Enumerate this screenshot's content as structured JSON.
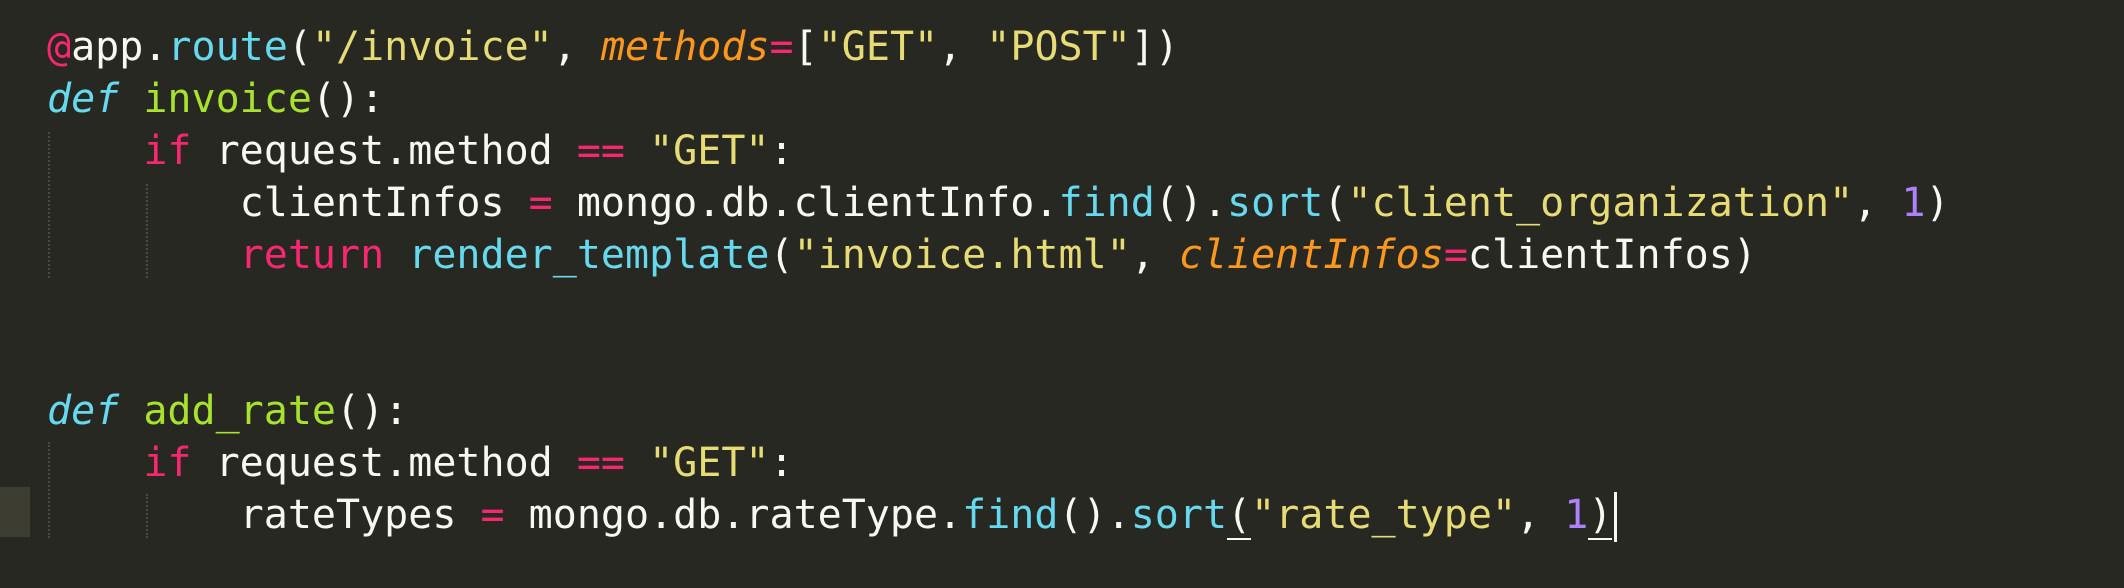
{
  "editor": {
    "colors": {
      "background": "#272822",
      "foreground": "#f8f8f2",
      "keyword": "#f92672",
      "storage": "#66d9ef",
      "function_name": "#a6e22e",
      "string": "#e6db74",
      "number": "#ae81ff",
      "parameter": "#fd971f"
    },
    "lines": [
      {
        "tokens": [
          {
            "type": "kw-deco",
            "text": "@"
          },
          {
            "type": "plain",
            "text": "app."
          },
          {
            "type": "fn-call",
            "text": "route"
          },
          {
            "type": "plain",
            "text": "("
          },
          {
            "type": "str",
            "text": "\"/invoice\""
          },
          {
            "type": "plain",
            "text": ", "
          },
          {
            "type": "param",
            "text": "methods"
          },
          {
            "type": "op",
            "text": "="
          },
          {
            "type": "plain",
            "text": "["
          },
          {
            "type": "str",
            "text": "\"GET\""
          },
          {
            "type": "plain",
            "text": ", "
          },
          {
            "type": "str",
            "text": "\"POST\""
          },
          {
            "type": "plain",
            "text": "])"
          }
        ]
      },
      {
        "tokens": [
          {
            "type": "kw-def",
            "text": "def"
          },
          {
            "type": "plain",
            "text": " "
          },
          {
            "type": "fn-name",
            "text": "invoice"
          },
          {
            "type": "plain",
            "text": "():"
          }
        ]
      },
      {
        "tokens": [
          {
            "type": "plain",
            "text": "    "
          },
          {
            "type": "kw",
            "text": "if"
          },
          {
            "type": "plain",
            "text": " request.method "
          },
          {
            "type": "op",
            "text": "=="
          },
          {
            "type": "plain",
            "text": " "
          },
          {
            "type": "str",
            "text": "\"GET\""
          },
          {
            "type": "plain",
            "text": ":"
          }
        ]
      },
      {
        "tokens": [
          {
            "type": "plain",
            "text": "        clientInfos "
          },
          {
            "type": "op",
            "text": "="
          },
          {
            "type": "plain",
            "text": " mongo.db.clientInfo."
          },
          {
            "type": "fn-call",
            "text": "find"
          },
          {
            "type": "plain",
            "text": "()."
          },
          {
            "type": "fn-call",
            "text": "sort"
          },
          {
            "type": "plain",
            "text": "("
          },
          {
            "type": "str",
            "text": "\"client_organization\""
          },
          {
            "type": "plain",
            "text": ", "
          },
          {
            "type": "num",
            "text": "1"
          },
          {
            "type": "plain",
            "text": ")"
          }
        ]
      },
      {
        "tokens": [
          {
            "type": "plain",
            "text": "        "
          },
          {
            "type": "kw",
            "text": "return"
          },
          {
            "type": "plain",
            "text": " "
          },
          {
            "type": "fn-call",
            "text": "render_template"
          },
          {
            "type": "plain",
            "text": "("
          },
          {
            "type": "str",
            "text": "\"invoice.html\""
          },
          {
            "type": "plain",
            "text": ", "
          },
          {
            "type": "param",
            "text": "clientInfos"
          },
          {
            "type": "op",
            "text": "="
          },
          {
            "type": "plain",
            "text": "clientInfos)"
          }
        ]
      },
      {
        "tokens": []
      },
      {
        "tokens": []
      },
      {
        "tokens": [
          {
            "type": "kw-def",
            "text": "def"
          },
          {
            "type": "plain",
            "text": " "
          },
          {
            "type": "fn-name",
            "text": "add_rate"
          },
          {
            "type": "plain",
            "text": "():"
          }
        ]
      },
      {
        "tokens": [
          {
            "type": "plain",
            "text": "    "
          },
          {
            "type": "kw",
            "text": "if"
          },
          {
            "type": "plain",
            "text": " request.method "
          },
          {
            "type": "op",
            "text": "=="
          },
          {
            "type": "plain",
            "text": " "
          },
          {
            "type": "str",
            "text": "\"GET\""
          },
          {
            "type": "plain",
            "text": ":"
          }
        ]
      },
      {
        "tokens": [
          {
            "type": "plain",
            "text": "        rateTypes "
          },
          {
            "type": "op",
            "text": "="
          },
          {
            "type": "plain",
            "text": " mongo.db.rateType."
          },
          {
            "type": "fn-call",
            "text": "find"
          },
          {
            "type": "plain",
            "text": "()."
          },
          {
            "type": "fn-call",
            "text": "sort"
          },
          {
            "type": "plain",
            "text": "(",
            "match": true
          },
          {
            "type": "str",
            "text": "\"rate_type\""
          },
          {
            "type": "plain",
            "text": ", "
          },
          {
            "type": "num",
            "text": "1"
          },
          {
            "type": "plain",
            "text": ")",
            "match": true
          }
        ],
        "cursor_at_end": true
      }
    ]
  }
}
